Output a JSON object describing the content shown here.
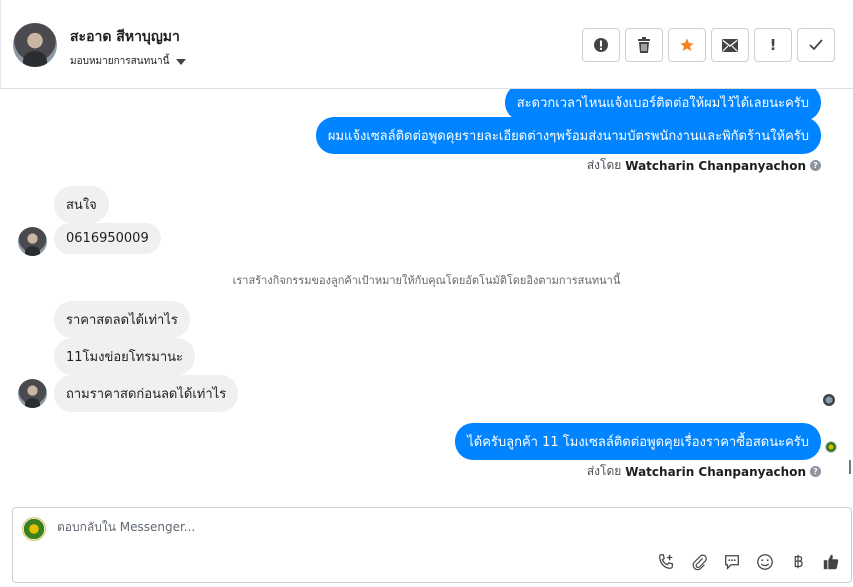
{
  "header": {
    "contact_name": "สะอาด สีหาบุญมา",
    "assign_label": "มอบหมายการสนทนานี้",
    "toolbar": {
      "spam": "!",
      "delete": "🗑",
      "star": "★",
      "mail": "✉",
      "important": "!",
      "done": "✓"
    }
  },
  "thread": {
    "outgoing_top_1": "สะดวกเวลาไหนแจ้งเบอร์ติดต่อให้ผมไว้ได้เลยนะครับ",
    "outgoing_top_2": "ผมแจ้งเซลล์ติดต่อพูดคุยรายละเอียดต่างๆพร้อมส่งนามบัตรพนักงานและพิกัดร้านให้ครับ",
    "sent_by_label": "ส่งโดย",
    "sent_by_name": "Watcharin Chanpanyachon",
    "incoming_1": "สนใจ",
    "incoming_2": "0616950009",
    "system_note": "เราสร้างกิจกรรมของลูกค้าเป้าหมายให้กับคุณโดยอัตโนมัติโดยอิงตามการสนทนานี้",
    "incoming_3": "ราคาสดลดได้เท่าไร",
    "incoming_4": "11โมงข่อยโทรมานะ",
    "incoming_5": "ถามราคาสดก่อนลดได้เท่าไร",
    "outgoing_last": "ได้ครับลูกค้า 11 โมงเซลล์ติดต่อพูดคุยเรื่องราคาซื้อสดนะครับ",
    "help_glyph": "?"
  },
  "composer": {
    "placeholder": "ตอบกลับใน Messenger..."
  }
}
